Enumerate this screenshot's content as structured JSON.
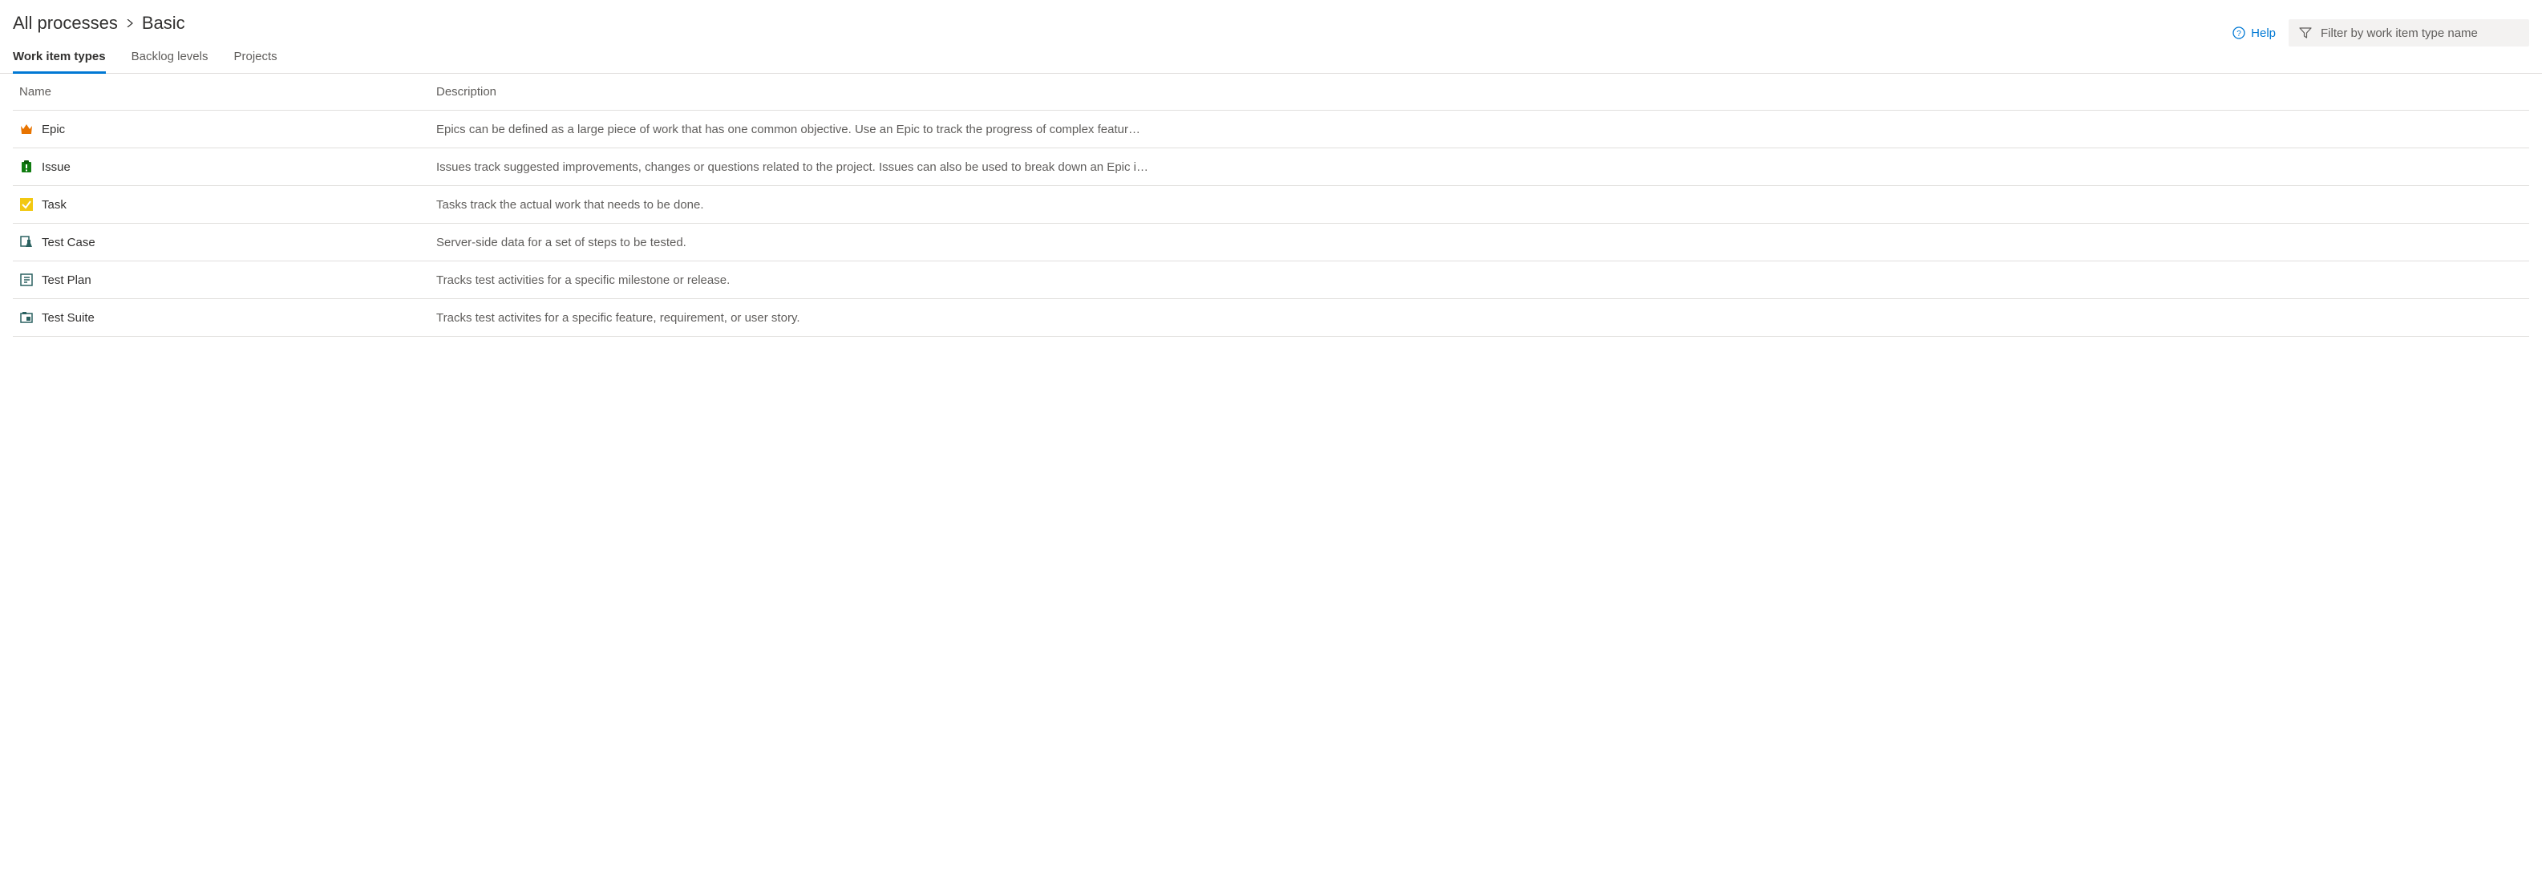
{
  "breadcrumb": {
    "parent": "All processes",
    "current": "Basic"
  },
  "tabs": [
    {
      "label": "Work item types",
      "active": true
    },
    {
      "label": "Backlog levels",
      "active": false
    },
    {
      "label": "Projects",
      "active": false
    }
  ],
  "help_label": "Help",
  "filter": {
    "placeholder": "Filter by work item type name"
  },
  "table": {
    "headers": {
      "name": "Name",
      "description": "Description"
    },
    "rows": [
      {
        "icon": "crown-icon",
        "name": "Epic",
        "description": "Epics can be defined as a large piece of work that has one common objective. Use an Epic to track the progress of complex featur…"
      },
      {
        "icon": "clipboard-icon",
        "name": "Issue",
        "description": "Issues track suggested improvements, changes or questions related to the project. Issues can also be used to break down an Epic i…"
      },
      {
        "icon": "check-box-icon",
        "name": "Task",
        "description": "Tasks track the actual work that needs to be done."
      },
      {
        "icon": "test-case-icon",
        "name": "Test Case",
        "description": "Server-side data for a set of steps to be tested."
      },
      {
        "icon": "test-plan-icon",
        "name": "Test Plan",
        "description": "Tracks test activities for a specific milestone or release."
      },
      {
        "icon": "test-suite-icon",
        "name": "Test Suite",
        "description": "Tracks test activites for a specific feature, requirement, or user story."
      }
    ]
  }
}
